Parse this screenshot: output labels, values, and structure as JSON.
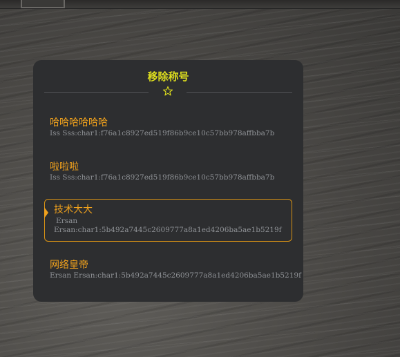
{
  "panel": {
    "title": "移除称号",
    "header_icon": "star-outline-icon",
    "accent_color": "#f0a11d",
    "title_color": "#dede1e",
    "items": [
      {
        "name": "哈哈哈哈哈哈",
        "owner_line": "Iss Sss:char1:f76a1c8927ed519f86b9ce10c57bb978affbba7b",
        "selected": false
      },
      {
        "name": "啦啦啦",
        "owner_line": "Iss Sss:char1:f76a1c8927ed519f86b9ce10c57bb978affbba7b",
        "selected": false
      },
      {
        "name": "技术大大",
        "owner_first": "Ersan",
        "owner_line": "Ersan:char1:5b492a7445c2609777a8a1ed4206ba5ae1b5219f",
        "selected": true
      },
      {
        "name": "网络皇帝",
        "owner_line": "Ersan Ersan:char1:5b492a7445c2609777a8a1ed4206ba5ae1b5219f",
        "selected": false
      }
    ]
  }
}
